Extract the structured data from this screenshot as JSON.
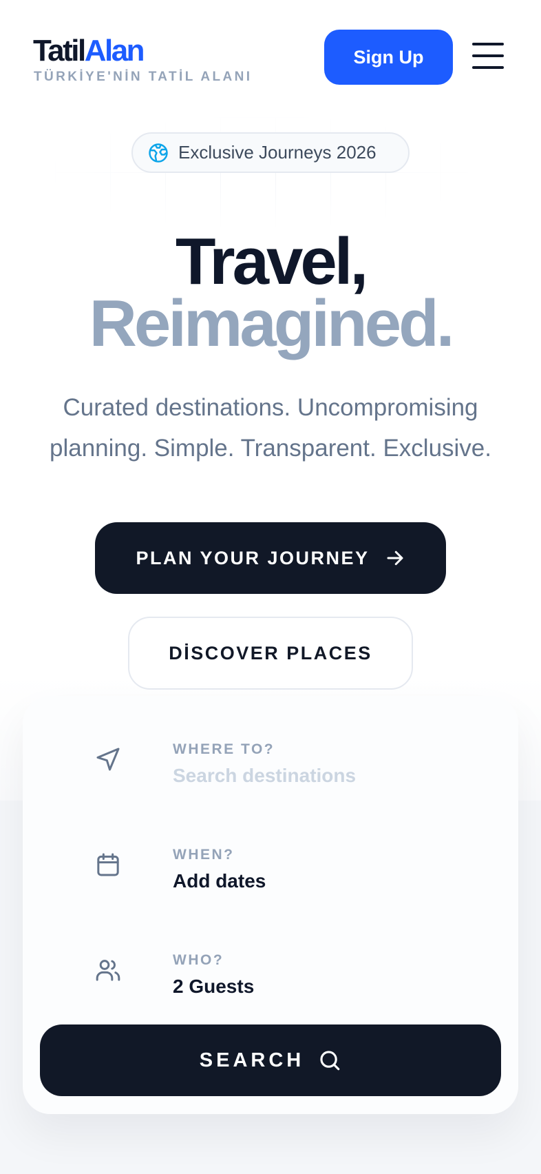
{
  "header": {
    "logo_part1": "Tatil",
    "logo_part2": "Alan",
    "tagline": "TÜRKİYE'NİN TATİL ALANI",
    "signup_label": "Sign Up",
    "menu_icon": "hamburger-menu-icon"
  },
  "hero": {
    "badge_icon": "globe-icon",
    "badge_text": "Exclusive Journeys 2026",
    "title_line1": "Travel,",
    "title_line2": "Reimagined.",
    "subtitle": "Curated destinations. Uncompromising planning. Simple. Transparent. Exclusive.",
    "primary_cta": "PLAN YOUR JOURNEY",
    "primary_cta_icon": "arrow-right-icon",
    "secondary_cta": "DİSCOVER PLACES"
  },
  "search": {
    "where": {
      "label": "WHERE TO?",
      "placeholder": "Search destinations",
      "value": "",
      "icon": "navigation-arrow-icon"
    },
    "when": {
      "label": "WHEN?",
      "value": "Add dates",
      "icon": "calendar-icon"
    },
    "who": {
      "label": "WHO?",
      "value": "2 Guests",
      "icon": "users-icon"
    },
    "button_label": "SEARCH",
    "button_icon": "search-icon"
  },
  "colors": {
    "brand_blue": "#1d5cff",
    "dark": "#111827",
    "muted": "#94a3b8",
    "title_muted": "#94a6bd",
    "badge_icon": "#0ea5e9"
  }
}
